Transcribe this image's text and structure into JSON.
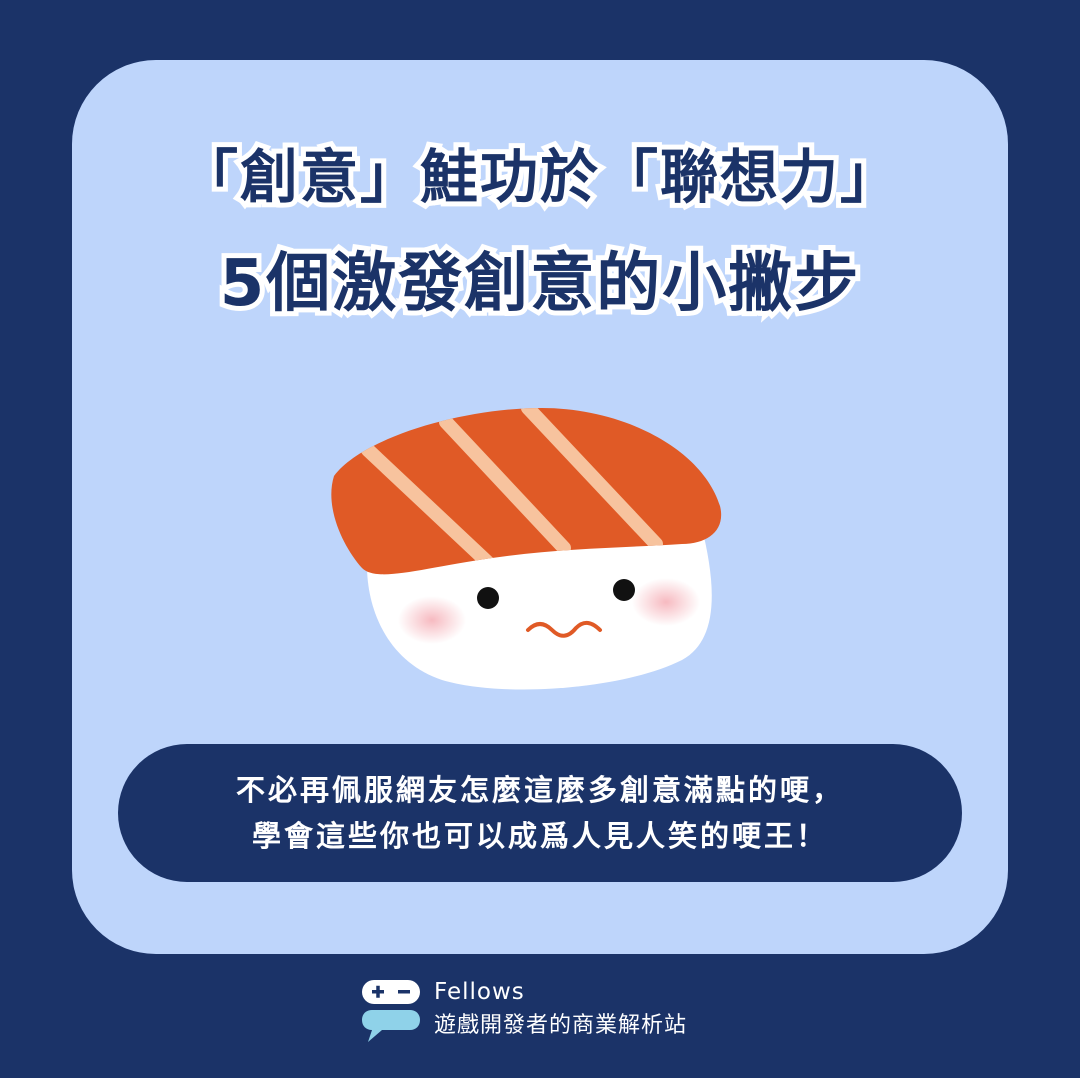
{
  "title": {
    "line1": "「創意」鮭功於「聯想力」",
    "line2": "5個激發創意的小撇步"
  },
  "illustration": {
    "icon": "salmon-sushi-character-icon"
  },
  "caption": {
    "line1": "不必再佩服網友怎麼這麼多創意滿點的哽，",
    "line2": "學會這些你也可以成爲人見人笑的哽王！"
  },
  "brand": {
    "name": "Fellows",
    "tagline": "遊戲開發者的商業解析站",
    "logo_icon": "gamepad-chat-bubble-icon"
  },
  "colors": {
    "background": "#1b3368",
    "card": "#bed5fb",
    "title_text": "#1b3368",
    "title_outline": "#ffffff",
    "salmon": "#e05a26",
    "salmon_stripe": "#f7c39e",
    "rice": "#ffffff",
    "cheek": "#f6b6bd",
    "mouth": "#e05a26",
    "pill": "#1b3368",
    "logo_bubble": "#8fd2e9"
  }
}
